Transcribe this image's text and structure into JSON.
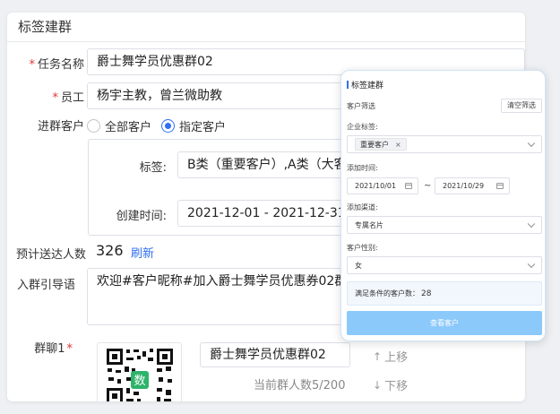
{
  "card": {
    "title": "标签建群"
  },
  "form": {
    "task_name": {
      "label": "任务名称",
      "required": "*",
      "value": "爵士舞学员优惠群02"
    },
    "staff": {
      "label": "员工",
      "required": "*",
      "value": "杨宇主教，曾兰微助教"
    },
    "customers": {
      "label": "进群客户",
      "options": [
        "全部客户",
        "指定客户"
      ],
      "selected": "指定客户"
    },
    "tags": {
      "label": "标签:",
      "value": "B类（重要客户）,A类（大客"
    },
    "created": {
      "label": "创建时间:",
      "value": "2021-12-01 - 2021-12-31"
    },
    "estimate": {
      "label": "预计送达人数",
      "count": "326",
      "refresh": "刷新"
    },
    "guide": {
      "label": "入群引导语",
      "value": "欢迎#客户昵称#加入爵士舞学员优惠券02群，"
    },
    "group": {
      "label": "群聊1",
      "required": "*",
      "name": "爵士舞学员优惠群02",
      "members": "当前群人数5/200",
      "move_up": "上移",
      "move_down": "下移",
      "qr_badge": "数"
    }
  },
  "panel": {
    "title": "标签建群",
    "filter_label": "客户筛选",
    "clear_button": "清空筛选",
    "corp_tag_label": "企业标签:",
    "corp_tag_chip": "重要客户",
    "chip_remove": "×",
    "time_label": "添加时间:",
    "date_from": "2021/10/01",
    "date_sep": "~",
    "date_to": "2021/10/29",
    "channel_label": "添加渠道:",
    "channel_value": "专属名片",
    "gender_label": "客户性别:",
    "gender_value": "女",
    "result_text": "满足条件的客户数：",
    "result_count": "28",
    "submit_button": "查看客户"
  },
  "colors": {
    "primary": "#2f6ff1",
    "required": "#e5322d",
    "submit": "#8cc9fb"
  }
}
